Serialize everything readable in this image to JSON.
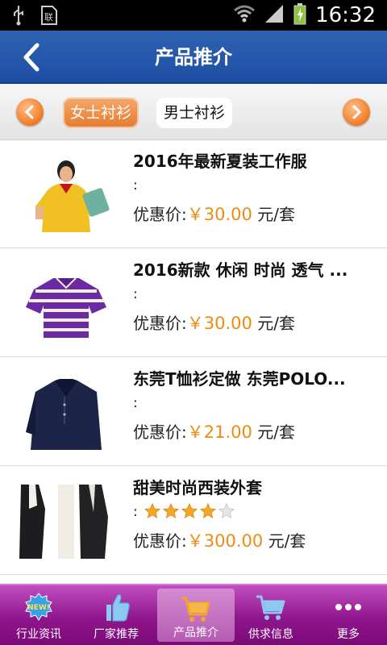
{
  "status_bar": {
    "time": "16:32"
  },
  "header": {
    "title": "产品推介"
  },
  "categories": [
    {
      "label": "女士衬衫",
      "active": true
    },
    {
      "label": "男士衬衫",
      "active": false
    }
  ],
  "products": [
    {
      "title": "2016年最新夏装工作服",
      "colon": ":",
      "price_label": "优惠价:",
      "price": "￥30.00",
      "unit": "元/套",
      "rating": null
    },
    {
      "title": "2016新款 休闲 时尚 透气 ...",
      "colon": ":",
      "price_label": "优惠价:",
      "price": "￥30.00",
      "unit": "元/套",
      "rating": null
    },
    {
      "title": "东莞T恤衫定做 东莞POLO...",
      "colon": ":",
      "price_label": "优惠价:",
      "price": "￥21.00",
      "unit": "元/套",
      "rating": null
    },
    {
      "title": "甜美时尚西装外套",
      "colon": ":",
      "price_label": "优惠价:",
      "price": "￥300.00",
      "unit": "元/套",
      "rating": 4,
      "rating_max": 5
    }
  ],
  "bottom_nav": [
    {
      "label": "行业资讯",
      "icon": "news-icon"
    },
    {
      "label": "厂家推荐",
      "icon": "thumbs-up-icon"
    },
    {
      "label": "产品推介",
      "icon": "cart-icon",
      "active": true
    },
    {
      "label": "供求信息",
      "icon": "cart-icon"
    },
    {
      "label": "更多",
      "icon": "more-icon"
    }
  ],
  "colors": {
    "header": "#2f62b3",
    "accent": "#f08a10",
    "nav": "#8f168d"
  }
}
